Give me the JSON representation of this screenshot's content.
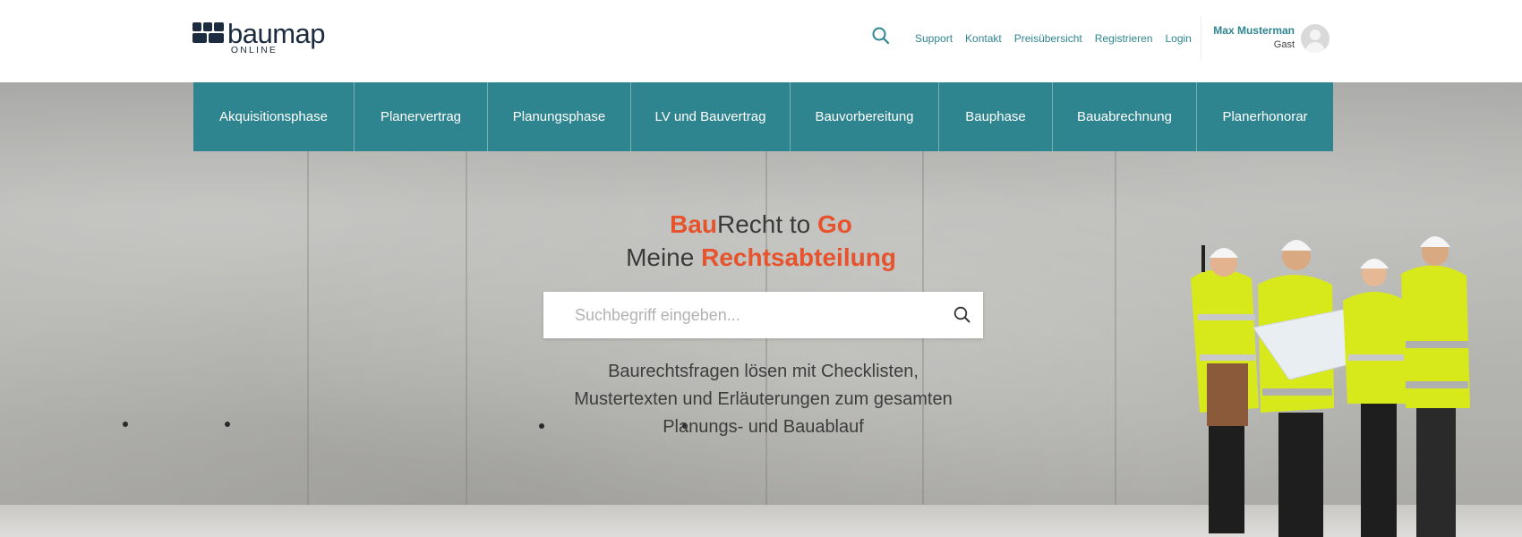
{
  "brand": {
    "name": "baumap",
    "subline": "ONLINE"
  },
  "header": {
    "links": [
      "Support",
      "Kontakt",
      "Preisübersicht",
      "Registrieren",
      "Login"
    ],
    "user": {
      "name": "Max Musterman",
      "role": "Gast"
    }
  },
  "phases": [
    "Akquisitionsphase",
    "Planervertrag",
    "Planungsphase",
    "LV und Bauvertrag",
    "Bauvorbereitung",
    "Bauphase",
    "Bauabrechnung",
    "Planerhonorar"
  ],
  "hero": {
    "line1": {
      "accent_a": "Bau",
      "plain": "Recht to ",
      "accent_b": "Go"
    },
    "line2": {
      "plain": "Meine ",
      "accent": "Rechtsabteilung"
    },
    "search_placeholder": "Suchbegriff eingeben...",
    "description": [
      "Baurechtsfragen lösen mit Checklisten,",
      "Mustertexten und Erläuterungen zum gesamten",
      "Planungs- und Bauablauf"
    ]
  },
  "colors": {
    "teal": "#2e858f",
    "accent": "#e6532d",
    "brand_dark": "#1c2b3f"
  },
  "icons": {
    "search": "search-icon",
    "avatar": "user-avatar-icon"
  }
}
